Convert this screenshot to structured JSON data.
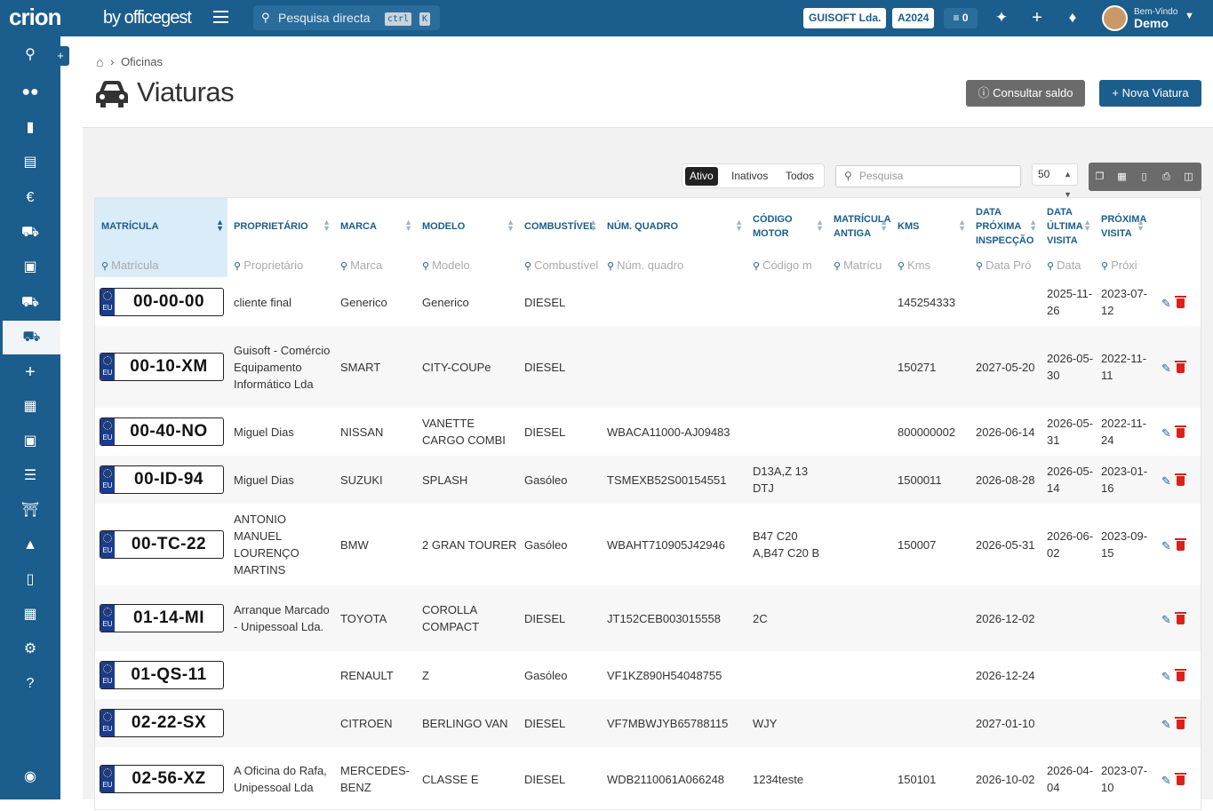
{
  "topbar": {
    "logo": "crion",
    "logo_sub": "by officegest",
    "search_placeholder": "Pesquisa directa",
    "kbd_ctrl": "ctrl",
    "kbd_k": "K",
    "company": "GUISOFT Lda.",
    "year": "A2024",
    "tasks_count": "0",
    "welcome": "Bem-Vindo",
    "user": "Demo"
  },
  "breadcrumb": {
    "current": "Oficinas"
  },
  "page": {
    "title": "Viaturas",
    "btn_saldo": "Consultar saldo",
    "btn_nova": "Nova Viatura"
  },
  "filters": {
    "active": "Ativo",
    "inactive": "Inativos",
    "all": "Todos",
    "search_placeholder": "Pesquisa",
    "page_size": "50"
  },
  "columns": [
    {
      "label": "MATRÍCULA",
      "filter": "Matrícula"
    },
    {
      "label": "PROPRIETÁRIO",
      "filter": "Proprietário"
    },
    {
      "label": "MARCA",
      "filter": "Marca"
    },
    {
      "label": "MODELO",
      "filter": "Modelo"
    },
    {
      "label": "COMBUSTÍVEL",
      "filter": "Combustível"
    },
    {
      "label": "NÚM. QUADRO",
      "filter": "Núm. quadro"
    },
    {
      "label": "CÓDIGO MOTOR",
      "filter": "Código m"
    },
    {
      "label": "MATRÍCULA ANTIGA",
      "filter": "Matrícu"
    },
    {
      "label": "KMS",
      "filter": "Kms"
    },
    {
      "label": "DATA PRÓXIMA INSPECÇÃO",
      "filter": "Data Pró"
    },
    {
      "label": "DATA ÚLTIMA VISITA",
      "filter": "Data"
    },
    {
      "label": "PRÓXIMA VISITA",
      "filter": "Próxi"
    }
  ],
  "rows": [
    {
      "plate": "00-00-00",
      "owner": "cliente final",
      "brand": "Generico",
      "model": "Generico",
      "fuel": "DIESEL",
      "chassis": "",
      "engine": "",
      "old_plate": "",
      "kms": "145254333",
      "next_insp": "",
      "last_visit": "2025-11-26",
      "next_visit": "2023-07-12"
    },
    {
      "plate": "00-10-XM",
      "owner": "Guisoft - Comércio Equipamento Informático Lda",
      "brand": "SMART",
      "model": "CITY-COUPe",
      "fuel": "DIESEL",
      "chassis": "",
      "engine": "",
      "old_plate": "",
      "kms": "150271",
      "next_insp": "2027-05-20",
      "last_visit": "2026-05-30",
      "next_visit": "2022-11-11"
    },
    {
      "plate": "00-40-NO",
      "owner": "Miguel Dias",
      "brand": "NISSAN",
      "model": "VANETTE CARGO COMBI",
      "fuel": "DIESEL",
      "chassis": "WBACA11000-AJ09483",
      "engine": "",
      "old_plate": "",
      "kms": "800000002",
      "next_insp": "2026-06-14",
      "last_visit": "2026-05-31",
      "next_visit": "2022-11-24"
    },
    {
      "plate": "00-ID-94",
      "owner": "Miguel Dias",
      "brand": "SUZUKI",
      "model": "SPLASH",
      "fuel": "Gasóleo",
      "chassis": "TSMEXB52S00154551",
      "engine": "D13A,Z 13 DTJ",
      "old_plate": "",
      "kms": "1500011",
      "next_insp": "2026-08-28",
      "last_visit": "2026-05-14",
      "next_visit": "2023-01-16"
    },
    {
      "plate": "00-TC-22",
      "owner": "ANTONIO MANUEL LOURENÇO MARTINS",
      "brand": "BMW",
      "model": "2 GRAN TOURER",
      "fuel": "Gasóleo",
      "chassis": "WBAHT710905J42946",
      "engine": "B47 C20 A,B47 C20 B",
      "old_plate": "",
      "kms": "150007",
      "next_insp": "2026-05-31",
      "last_visit": "2026-06-02",
      "next_visit": "2023-09-15"
    },
    {
      "plate": "01-14-MI",
      "owner": "Arranque Marcado - Unipessoal Lda.",
      "brand": "TOYOTA",
      "model": "COROLLA COMPACT",
      "fuel": "DIESEL",
      "chassis": "JT152CEB003015558",
      "engine": "2C",
      "old_plate": "",
      "kms": "",
      "next_insp": "2026-12-02",
      "last_visit": "",
      "next_visit": ""
    },
    {
      "plate": "01-QS-11",
      "owner": "",
      "brand": "RENAULT",
      "model": "Z",
      "fuel": "Gasóleo",
      "chassis": "VF1KZ890H54048755",
      "engine": "",
      "old_plate": "",
      "kms": "",
      "next_insp": "2026-12-24",
      "last_visit": "",
      "next_visit": ""
    },
    {
      "plate": "02-22-SX",
      "owner": "",
      "brand": "CITROEN",
      "model": "BERLINGO VAN",
      "fuel": "DIESEL",
      "chassis": "VF7MBWJYB65788115",
      "engine": "WJY",
      "old_plate": "",
      "kms": "",
      "next_insp": "2027-01-10",
      "last_visit": "",
      "next_visit": ""
    },
    {
      "plate": "02-56-XZ",
      "owner": "A Oficina do Rafa, Unipessoal Lda",
      "brand": "MERCEDES-BENZ",
      "model": "CLASSE E",
      "fuel": "DIESEL",
      "chassis": "WDB2110061A066248",
      "engine": "1234teste",
      "old_plate": "",
      "kms": "150101",
      "next_insp": "2026-10-02",
      "last_visit": "2026-04-04",
      "next_visit": "2023-07-10"
    }
  ],
  "plate_badge": "EU",
  "colors": {
    "primary": "#1b5d8c",
    "danger": "#d9221c",
    "gray_button": "#6b6b6b"
  }
}
